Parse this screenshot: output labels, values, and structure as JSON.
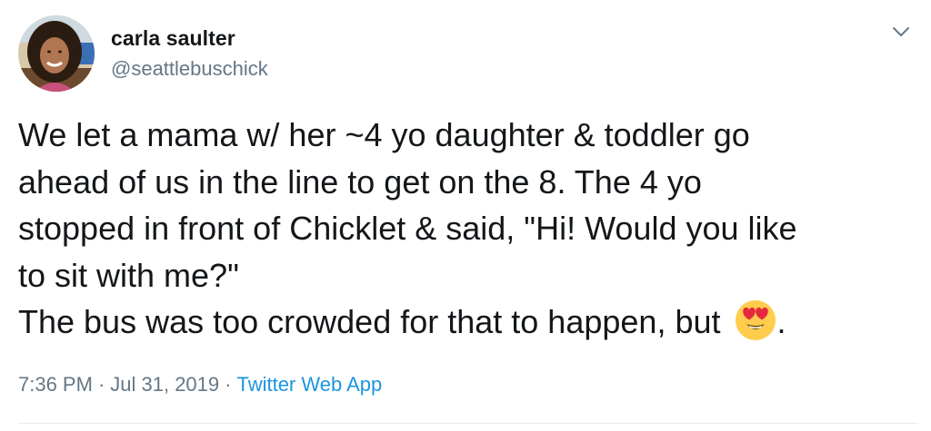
{
  "author": {
    "display_name": "carla saulter",
    "handle": "@seattlebuschick",
    "avatar_icon": "profile-photo"
  },
  "menu": {
    "icon": "chevron-down-icon"
  },
  "tweet": {
    "lines": [
      "We let a mama w/ her ~4 yo daughter & toddler go",
      "ahead of us in the line to get on the 8. The 4 yo",
      "stopped in front of Chicklet & said, \"Hi! Would you like",
      "to sit with me?\"",
      "The bus was too crowded for that to happen, but"
    ],
    "emoji": "smiling-face-with-heart-eyes",
    "trailing": "."
  },
  "meta": {
    "time": "7:36 PM",
    "date": "Jul 31, 2019",
    "separator": "·",
    "source": "Twitter Web App"
  },
  "colors": {
    "text": "#14171a",
    "secondary": "#657786",
    "link": "#1b95e0",
    "divider": "#e6ecf0"
  }
}
